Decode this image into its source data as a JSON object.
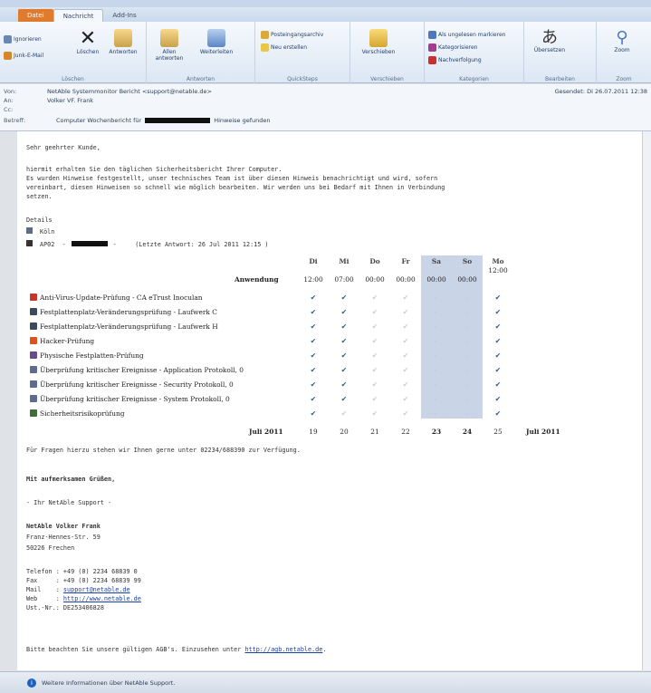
{
  "tabs": [
    "Datei",
    "Nachricht",
    "Add-Ins"
  ],
  "ribbon": {
    "ignore": "Ignorieren",
    "junk": "Junk-E-Mail",
    "delete": "Löschen",
    "reply": "Antworten",
    "reply_all": "Allen antworten",
    "forward": "Weiterleiten",
    "group_delete": "Löschen",
    "group_respond": "Antworten",
    "qs1": "Posteingangsarchiv",
    "qs2": "Neu erstellen",
    "group_quicksteps": "QuickSteps",
    "move": "Verschieben",
    "group_move": "Verschieben",
    "mark_unread": "Als ungelesen markieren",
    "categorize": "Kategorisieren",
    "followup": "Nachverfolgung",
    "group_tags": "Kategorien",
    "translate": "Übersetzen",
    "group_edit": "Bearbeiten",
    "zoom": "Zoom",
    "group_zoom": "Zoom"
  },
  "header": {
    "from_label": "Von:",
    "from": "NetAble Systemmonitor Bericht <support@netable.de>",
    "to_label": "An:",
    "to": "Volker VF. Frank",
    "cc_label": "Cc:",
    "subject_label": "Betreff:",
    "subject_a": "Computer Wochenbericht für",
    "subject_b": "Hinweise gefunden",
    "sent_label": "Gesendet:",
    "sent": "Di 26.07.2011 12:38"
  },
  "body": {
    "greeting": "Sehr geehrter Kunde,",
    "intro1": "hiermit erhalten Sie den täglichen Sicherheitsbericht Ihrer Computer.",
    "intro2": "Es wurden Hinweise festgestellt, unser technisches Team ist über diesen Hinweis benachrichtigt und wird, sofern",
    "intro3": "vereinbart, diesen Hinweisen so schnell wie möglich bearbeiten. Wir werden uns bei Bedarf mit Ihnen in Verbindung",
    "intro4": "setzen.",
    "details": "Details",
    "location": "Köln",
    "device_a": "AP02  -",
    "device_b": "-     (Letzte Antwort: 26 Jul 2011 12:15 )",
    "questions": "Für Fragen hierzu stehen wir Ihnen gerne unter 02234/688390 zur Verfügung.",
    "regards": "Mit aufmerksamen Grüßen,",
    "team": "- Ihr NetAble Support -",
    "addr1": "NetAble Volker Frank",
    "addr2": "Franz-Hennes-Str. 59",
    "addr3": "50226 Frechen",
    "tel": "Telefon : +49 (0) 2234 68839 0",
    "fax": "Fax     : +49 (0) 2234 68839 99",
    "mail_label": "Mail    : ",
    "mail": "support@netable.de",
    "web_label": "Web     : ",
    "web": "http://www.netable.de",
    "ust": "Ust.-Nr.: DE253406828",
    "agb_a": "Bitte beachten Sie unsere gültigen AGB's. Einzusehen unter ",
    "agb_link": "http://agb.netable.de",
    "agb_b": "."
  },
  "table": {
    "days": [
      "Di",
      "Mi",
      "Do",
      "Fr",
      "Sa",
      "So",
      "Mo"
    ],
    "app_label": "Anwendung",
    "times": [
      "12:00",
      "07:00",
      "00:00",
      "00:00",
      "00:00",
      "00:00",
      "12:00"
    ],
    "rows": [
      {
        "label": "Anti-Virus-Update-Prüfung - CA eTrust Inoculan",
        "icon": "#c0392b",
        "checks": [
          1,
          1,
          0,
          0,
          0,
          0,
          1
        ]
      },
      {
        "label": "Festplattenplatz-Veränderungsprüfung - Laufwerk C",
        "icon": "#3b4a5c",
        "checks": [
          1,
          1,
          0,
          0,
          0,
          0,
          1
        ]
      },
      {
        "label": "Festplattenplatz-Veränderungsprüfung - Laufwerk H",
        "icon": "#3b4a5c",
        "checks": [
          1,
          1,
          0,
          0,
          0,
          0,
          1
        ]
      },
      {
        "label": "Hacker-Prüfung",
        "icon": "#d9531e",
        "checks": [
          1,
          1,
          0,
          0,
          0,
          0,
          1
        ]
      },
      {
        "label": "Physische Festplatten-Prüfung",
        "icon": "#6b4b8a",
        "checks": [
          1,
          1,
          0,
          0,
          0,
          0,
          1
        ]
      },
      {
        "label": "Überprüfung kritischer Ereignisse - Application Protokoll, 0",
        "icon": "#5b6d8a",
        "checks": [
          1,
          1,
          0,
          0,
          0,
          0,
          1
        ]
      },
      {
        "label": "Überprüfung kritischer Ereignisse - Security Protokoll, 0",
        "icon": "#5b6d8a",
        "checks": [
          1,
          1,
          0,
          0,
          0,
          0,
          1
        ]
      },
      {
        "label": "Überprüfung kritischer Ereignisse - System Protokoll, 0",
        "icon": "#5b6d8a",
        "checks": [
          1,
          1,
          0,
          0,
          0,
          0,
          1
        ]
      },
      {
        "label": "Sicherheitsrisikoprüfung",
        "icon": "#3f6c3a",
        "checks": [
          1,
          0,
          0,
          0,
          0,
          0,
          1
        ]
      }
    ],
    "month_left": "Juli 2011",
    "dates": [
      "19",
      "20",
      "21",
      "22",
      "23",
      "24",
      "25"
    ],
    "month_right": "Juli 2011"
  },
  "status": {
    "text": "Weitere Informationen über NetAble Support."
  }
}
